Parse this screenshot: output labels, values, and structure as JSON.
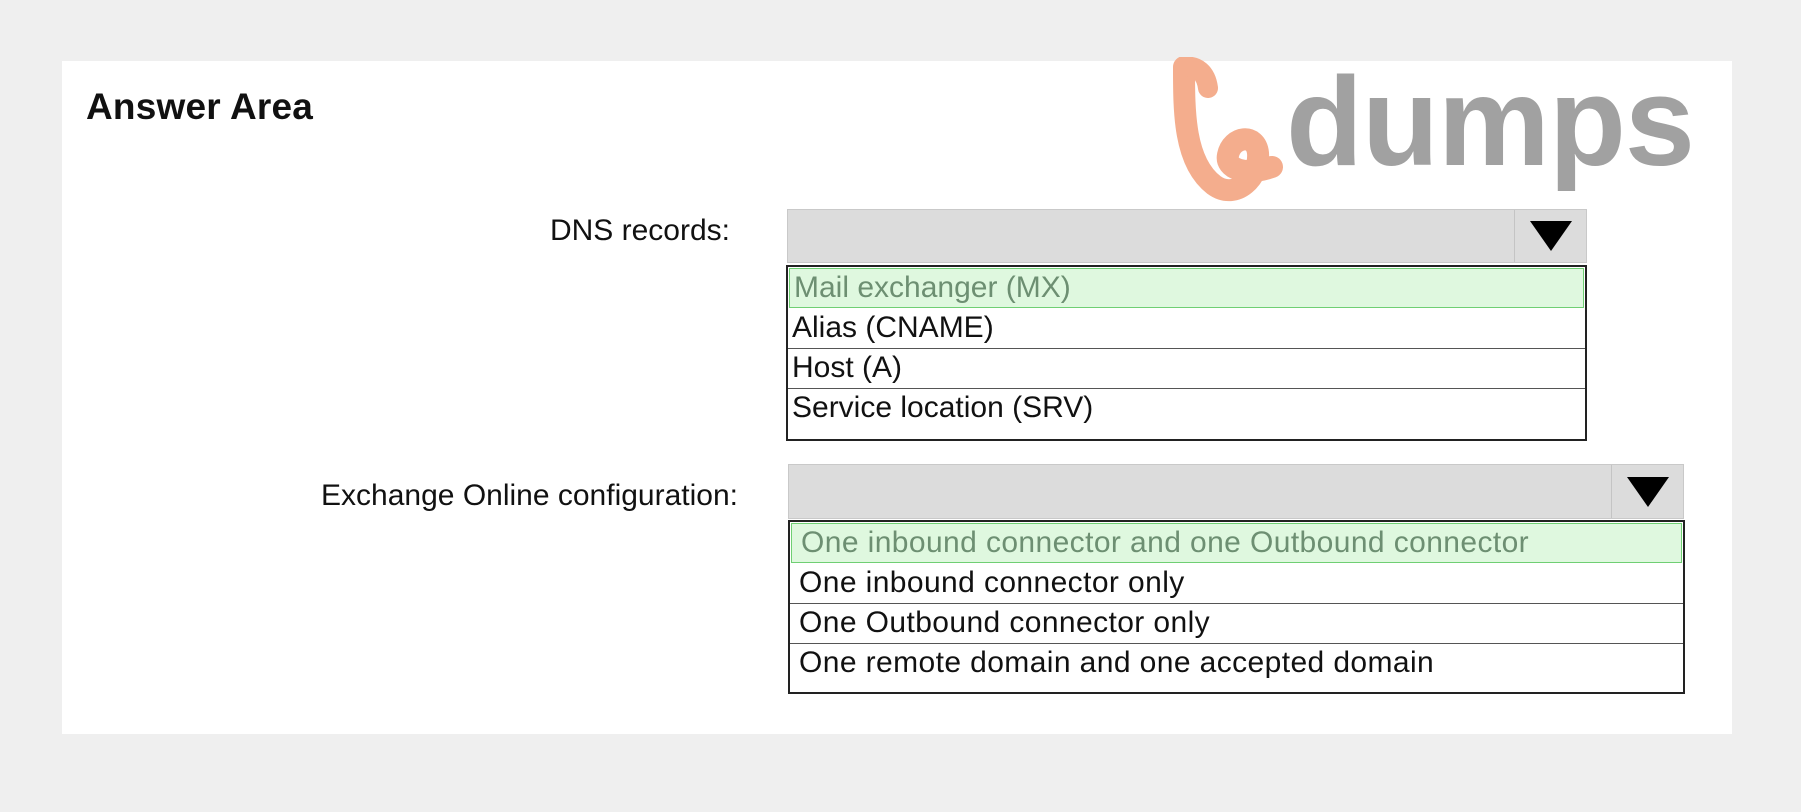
{
  "title": "Answer Area",
  "watermark": {
    "text": "dumps",
    "accent": "#f4ad8d"
  },
  "dns": {
    "label": "DNS records:",
    "selected_value": "",
    "options": [
      "Mail exchanger (MX)",
      "Alias (CNAME)",
      "Host (A)",
      "Service location (SRV)"
    ],
    "highlighted_index": 0
  },
  "exchange": {
    "label": "Exchange Online configuration:",
    "selected_value": "",
    "options": [
      "One inbound connector and one Outbound connector",
      "One inbound connector only",
      "One Outbound connector only",
      "One remote domain and one accepted domain"
    ],
    "highlighted_index": 0
  },
  "colors": {
    "background": "#efefef",
    "panel": "#ffffff",
    "select_fill": "#dcdcdc",
    "highlight": "#dff8df",
    "highlight_text": "#6d8f72"
  }
}
